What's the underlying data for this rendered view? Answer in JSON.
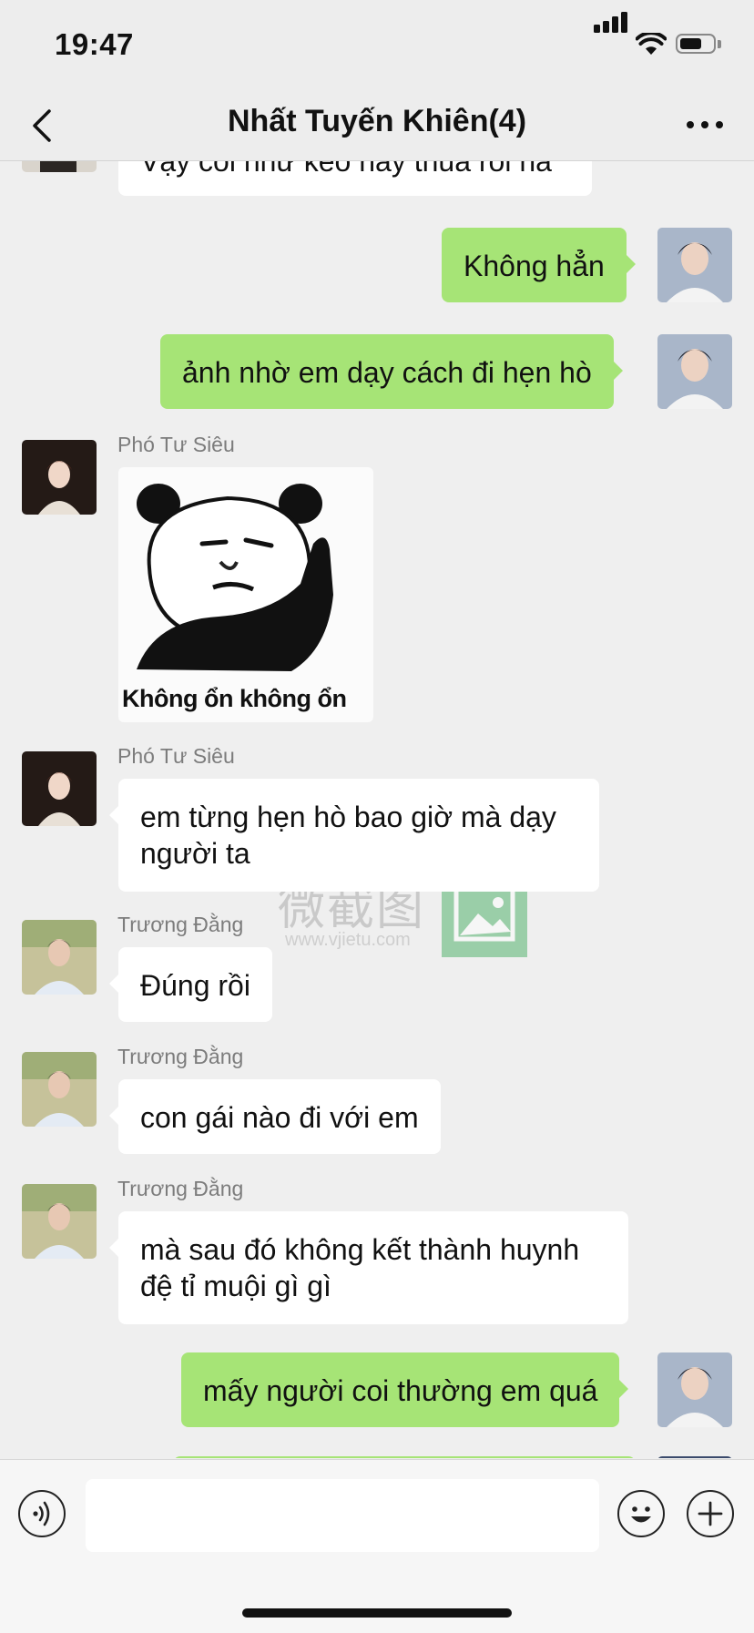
{
  "status_bar": {
    "time": "19:47"
  },
  "header": {
    "title": "Nhất Tuyến Khiên(4)"
  },
  "messages": [
    {
      "side": "in",
      "text": "Vậy coi như kèo này thua rồi hả"
    },
    {
      "side": "out",
      "text": "Không hẳn"
    },
    {
      "side": "out",
      "text": "ảnh nhờ em dạy cách đi hẹn hò"
    },
    {
      "side": "in",
      "sender": "Phó Tư Siêu",
      "sticker_caption": "Không ổn không ổn"
    },
    {
      "side": "in",
      "sender": "Phó Tư Siêu",
      "text": "em từng hẹn hò bao giờ mà dạy người ta"
    },
    {
      "side": "in",
      "sender": "Trương Đằng",
      "text": "Đúng rồi"
    },
    {
      "side": "in",
      "sender": "Trương Đằng",
      "text": "con gái nào đi với em"
    },
    {
      "side": "in",
      "sender": "Trương Đằng",
      "text": "mà sau đó không kết thành huynh đệ tỉ muội gì gì"
    },
    {
      "side": "out",
      "text": "mấy người coi thường em quá"
    }
  ],
  "watermark": {
    "text": "微截图",
    "url": "www.vjietu.com"
  },
  "input_bar": {
    "value": ""
  },
  "colors": {
    "out_bubble": "#a6e476",
    "in_bubble": "#ffffff",
    "background": "#efefef"
  },
  "icons": [
    "back-chevron-icon",
    "more-icon",
    "voice-icon",
    "emoji-icon",
    "plus-icon"
  ]
}
